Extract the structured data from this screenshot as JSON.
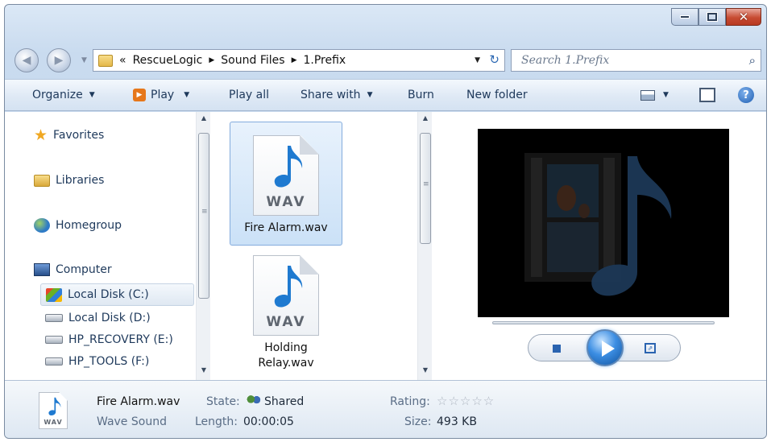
{
  "window": {
    "close_glyph": "✕"
  },
  "address": {
    "overflow": "«",
    "crumbs": [
      "RescueLogic",
      "Sound Files",
      "1.Prefix"
    ],
    "separator": "▶",
    "dropdown": "▼",
    "refresh_glyph": "↻"
  },
  "search": {
    "placeholder": "Search 1.Prefix",
    "icon_glyph": "⌕"
  },
  "toolbar": {
    "organize": "Organize",
    "play": "Play",
    "play_all": "Play all",
    "share_with": "Share with",
    "burn": "Burn",
    "new_folder": "New folder",
    "caret": "▼",
    "help": "?"
  },
  "nav": {
    "favorites": "Favorites",
    "libraries": "Libraries",
    "homegroup": "Homegroup",
    "computer": "Computer",
    "drives": [
      "Local Disk (C:)",
      "Local Disk (D:)",
      "HP_RECOVERY (E:)",
      "HP_TOOLS (F:)"
    ],
    "star_glyph": "★"
  },
  "scrollbar": {
    "up": "▲",
    "down": "▼",
    "grip": "≡"
  },
  "files": [
    {
      "name": "Fire Alarm.wav",
      "badge": "WAV"
    },
    {
      "name": "Holding Relay.wav",
      "name_line1": "Holding",
      "name_line2": "Relay.wav",
      "badge": "WAV"
    }
  ],
  "preview": {
    "switch_glyph": "⇗"
  },
  "details": {
    "file_name": "Fire Alarm.wav",
    "file_type": "Wave Sound",
    "badge": "WAV",
    "state_label": "State:",
    "state_value": "Shared",
    "length_label": "Length:",
    "length_value": "00:00:05",
    "rating_label": "Rating:",
    "rating_stars": "☆☆☆☆☆",
    "size_label": "Size:",
    "size_value": "493 KB"
  },
  "colors": {
    "accent": "#2a63b0",
    "titlebar": "#c9dbef",
    "close": "#c74b32",
    "music_note": "#1f7ad0"
  },
  "icons": [
    "back-icon",
    "forward-icon",
    "folder-icon",
    "refresh-icon",
    "search-icon",
    "play-icon",
    "view-icon",
    "preview-pane-icon",
    "help-icon",
    "star-icon",
    "library-icon",
    "homegroup-icon",
    "computer-icon",
    "drive-icon",
    "music-note-icon",
    "stop-icon",
    "switch-view-icon",
    "shared-people-icon"
  ]
}
